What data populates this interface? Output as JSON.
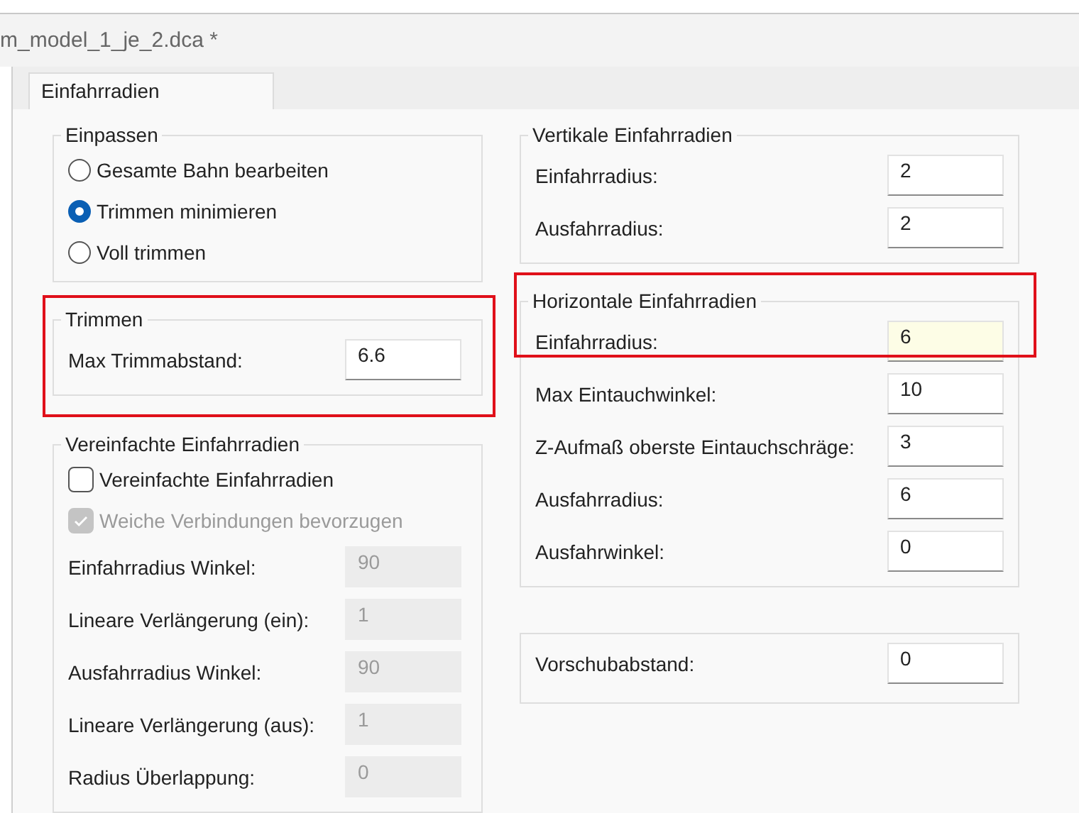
{
  "document_title": "m_model_1_je_2.dca *",
  "tabs": [
    {
      "label": "Einfahrradien",
      "selected": true
    }
  ],
  "left_groups": [
    {
      "title": "Einpassen",
      "kind": "plain",
      "items": [
        {
          "kind": "radio",
          "label": "Gesamte Bahn bearbeiten",
          "selected": false
        },
        {
          "kind": "radio",
          "label": "Trimmen minimieren",
          "selected": true
        },
        {
          "kind": "radio",
          "label": "Voll trimmen",
          "selected": false
        }
      ]
    },
    {
      "title": "Trimmen",
      "kind": "boxed",
      "items": [
        {
          "kind": "field",
          "label": "Max Trimmabstand:",
          "value": "6.6",
          "disabled": false,
          "focused": false
        }
      ]
    },
    {
      "title": "Vereinfachte Einfahrradien",
      "kind": "plain",
      "items": [
        {
          "kind": "checkbox",
          "label": "Vereinfachte Einfahrradien",
          "checked": false,
          "disabled": false
        },
        {
          "kind": "checkbox",
          "label": "Weiche Verbindungen bevorzugen",
          "checked": true,
          "disabled": true
        },
        {
          "kind": "field",
          "label": "Einfahrradius Winkel:",
          "value": "90",
          "disabled": true,
          "focused": false
        },
        {
          "kind": "field",
          "label": "Lineare Verlängerung (ein):",
          "value": "1",
          "disabled": true,
          "focused": false
        },
        {
          "kind": "field",
          "label": "Ausfahrradius Winkel:",
          "value": "90",
          "disabled": true,
          "focused": false
        },
        {
          "kind": "field",
          "label": "Lineare Verlängerung (aus):",
          "value": "1",
          "disabled": true,
          "focused": false
        },
        {
          "kind": "field",
          "label": "Radius Überlappung:",
          "value": "0",
          "disabled": true,
          "focused": false
        }
      ]
    }
  ],
  "right_groups": [
    {
      "title": "Vertikale Einfahrradien",
      "kind": "plain",
      "items": [
        {
          "kind": "field",
          "label": "Einfahrradius:",
          "value": "2",
          "disabled": false,
          "focused": false
        },
        {
          "kind": "field",
          "label": "Ausfahrradius:",
          "value": "2",
          "disabled": false,
          "focused": false
        }
      ]
    },
    {
      "title": "Horizontale Einfahrradien",
      "kind": "headboxed",
      "items": [
        {
          "kind": "field",
          "label": "Einfahrradius:",
          "value": "6",
          "disabled": false,
          "focused": true
        },
        {
          "kind": "field",
          "label": "Max Eintauchwinkel:",
          "value": "10",
          "disabled": false,
          "focused": false
        },
        {
          "kind": "field",
          "label": "Z-Aufmaß oberste Eintauchschräge:",
          "value": "3",
          "disabled": false,
          "focused": false
        },
        {
          "kind": "field",
          "label": "Ausfahrradius:",
          "value": "6",
          "disabled": false,
          "focused": false
        },
        {
          "kind": "field",
          "label": "Ausfahrwinkel:",
          "value": "0",
          "disabled": false,
          "focused": false
        }
      ]
    },
    {
      "kind": "plain",
      "items": [
        {
          "kind": "field",
          "label": "Vorschubabstand:",
          "value": "0",
          "disabled": false,
          "focused": false
        }
      ]
    }
  ]
}
